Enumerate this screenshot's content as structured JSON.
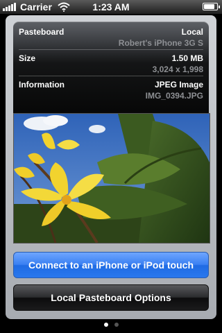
{
  "status_bar": {
    "carrier": "Carrier",
    "time": "1:23 AM",
    "battery_level": 0.85
  },
  "info": {
    "pasteboard_label": "Pasteboard",
    "pasteboard_value": "Local",
    "pasteboard_sub": "Robert's iPhone 3G S",
    "size_label": "Size",
    "size_value": "1.50 MB",
    "size_sub": "3,024 x 1,998",
    "information_label": "Information",
    "information_value": "JPEG Image",
    "information_sub": "IMG_0394.JPG"
  },
  "buttons": {
    "connect": "Connect to an iPhone or iPod touch",
    "options": "Local Pasteboard Options"
  },
  "pagination": {
    "pages": 2,
    "current": 1
  },
  "colors": {
    "accent_blue": "#2a78ee",
    "sky": "#3f73c6",
    "flower_yellow": "#f2d32e"
  }
}
